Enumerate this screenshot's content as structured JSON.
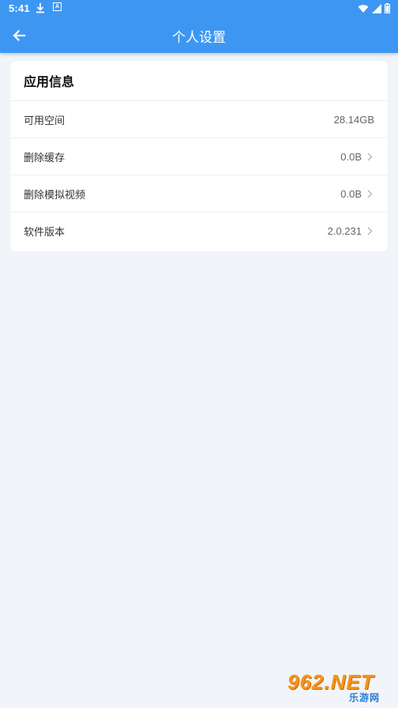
{
  "status_bar": {
    "time": "5:41",
    "notification_icons": [
      "download-icon",
      "a-notification-icon"
    ],
    "system_icons": [
      "wifi-icon",
      "signal-icon",
      "battery-icon"
    ]
  },
  "app_bar": {
    "title": "个人设置",
    "back_icon": "arrow-left-icon",
    "background_color": "#3d97f2"
  },
  "card": {
    "header": "应用信息",
    "rows": [
      {
        "label": "可用空间",
        "value": "28.14GB",
        "chevron": false
      },
      {
        "label": "删除缓存",
        "value": "0.0B",
        "chevron": true
      },
      {
        "label": "删除模拟视频",
        "value": "0.0B",
        "chevron": true
      },
      {
        "label": "软件版本",
        "value": "2.0.231",
        "chevron": true
      }
    ]
  },
  "watermark": {
    "main": "962.NET",
    "sub": "乐游网"
  }
}
